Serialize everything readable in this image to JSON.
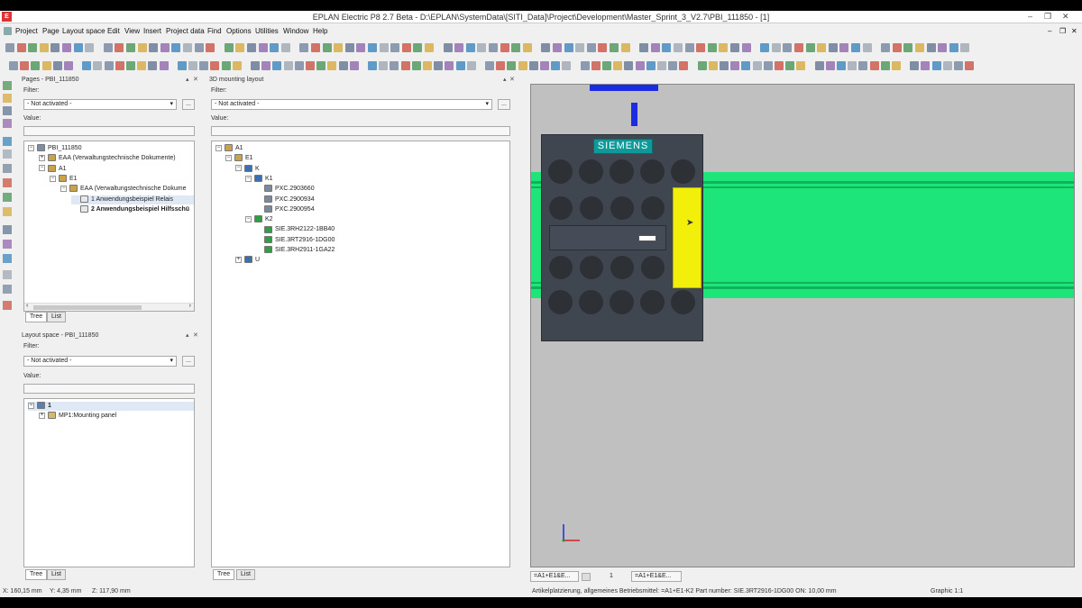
{
  "window": {
    "title": "EPLAN Electric P8 2.7 Beta - D:\\EPLAN\\SystemData\\[SITI_Data]\\Project\\Development\\Master_Sprint_3_V2.7\\PBI_111850 - [1]",
    "logo_text": "E",
    "win_buttons": [
      "–",
      "❐",
      "✕"
    ],
    "mdi_buttons": [
      "–",
      "❐",
      "✕"
    ]
  },
  "menu": [
    "Project",
    "Page",
    "Layout space",
    "Edit",
    "View",
    "Insert",
    "Project data",
    "Find",
    "Options",
    "Utilities",
    "Window",
    "Help"
  ],
  "pages_panel": {
    "title": "Pages - PBI_111850",
    "filter_label": "Filter:",
    "filter_value": "- Not activated -",
    "value_label": "Value:",
    "tree": [
      {
        "text": "PBI_111850",
        "level": 0,
        "expander": "−",
        "icon": "project-icon"
      },
      {
        "text": "EAA (Verwaltungstechnische Dokumente)",
        "level": 1,
        "expander": "+",
        "icon": "folder-icon"
      },
      {
        "text": "A1",
        "level": 1,
        "expander": "−",
        "icon": "folder-icon"
      },
      {
        "text": "E1",
        "level": 2,
        "expander": "−",
        "icon": "folder-icon"
      },
      {
        "text": "EAA (Verwaltungstechnische Dokume",
        "level": 3,
        "expander": "−",
        "icon": "folder-icon"
      },
      {
        "text": "1 Anwendungsbeispiel Relais",
        "level": 4,
        "expander": "",
        "icon": "page-icon",
        "selected": true
      },
      {
        "text": "2 Anwendungsbeispiel Hilfsschü",
        "level": 4,
        "expander": "",
        "icon": "page-icon",
        "bold": true
      }
    ],
    "tabs": [
      "Tree",
      "List"
    ]
  },
  "layout_panel": {
    "title": "Layout space - PBI_111850",
    "filter_label": "Filter:",
    "filter_value": "- Not activated -",
    "value_label": "Value:",
    "tree": [
      {
        "text": "1",
        "level": 0,
        "expander": "−",
        "icon": "layout-icon",
        "bold": true,
        "selected": true
      },
      {
        "text": "MP1:Mounting panel",
        "level": 1,
        "expander": "+",
        "icon": "panel-icon"
      }
    ],
    "tabs": [
      "Tree",
      "List"
    ]
  },
  "mounting_panel": {
    "title": "3D mounting layout",
    "filter_label": "Filter:",
    "filter_value": "- Not activated -",
    "value_label": "Value:",
    "tree": [
      {
        "text": "A1",
        "level": 0,
        "expander": "−",
        "icon": "folder-icon"
      },
      {
        "text": "E1",
        "level": 1,
        "expander": "−",
        "icon": "folder-icon"
      },
      {
        "text": "K",
        "level": 2,
        "expander": "−",
        "icon": "device-icon"
      },
      {
        "text": "K1",
        "level": 3,
        "expander": "−",
        "icon": "device-icon"
      },
      {
        "text": "PXC.2903660",
        "level": 4,
        "expander": "",
        "icon": "part-icon"
      },
      {
        "text": "PXC.2900934",
        "level": 4,
        "expander": "",
        "icon": "part-icon"
      },
      {
        "text": "PXC.2900954",
        "level": 4,
        "expander": "",
        "icon": "part-icon"
      },
      {
        "text": "K2",
        "level": 3,
        "expander": "−",
        "icon": "device-check-icon"
      },
      {
        "text": "SIE.3RH2122-1BB40",
        "level": 4,
        "expander": "",
        "icon": "part-check-icon"
      },
      {
        "text": "SIE.3RT2916-1DG00",
        "level": 4,
        "expander": "",
        "icon": "part-check-icon"
      },
      {
        "text": "SIE.3RH2911-1GA22",
        "level": 4,
        "expander": "",
        "icon": "part-check-icon"
      },
      {
        "text": "U",
        "level": 2,
        "expander": "+",
        "icon": "device-icon"
      }
    ],
    "tabs": [
      "Tree",
      "List"
    ]
  },
  "canvas": {
    "brand": "SIEMENS",
    "doc_tabs": [
      "=A1+E1&E...",
      "1",
      "=A1+E1&E..."
    ]
  },
  "status": {
    "x": "X:  160,15 mm",
    "y": "Y:  4,35 mm",
    "z": "Z:  117,90 mm",
    "message": "Artikelplatzierung, allgemeines Betriebsmittel: =A1+E1-K2 Part number: SIE.3RT2916-1DG00  ON: 10,00 mm",
    "graphic": "Graphic 1:1"
  },
  "colors": {
    "rail_green": "#1ee57a",
    "contactor_body": "#3f4650",
    "accent_yellow": "#f2ef0a",
    "marker_blue": "#1a2be0",
    "siemens_teal": "#0f9a9a"
  }
}
